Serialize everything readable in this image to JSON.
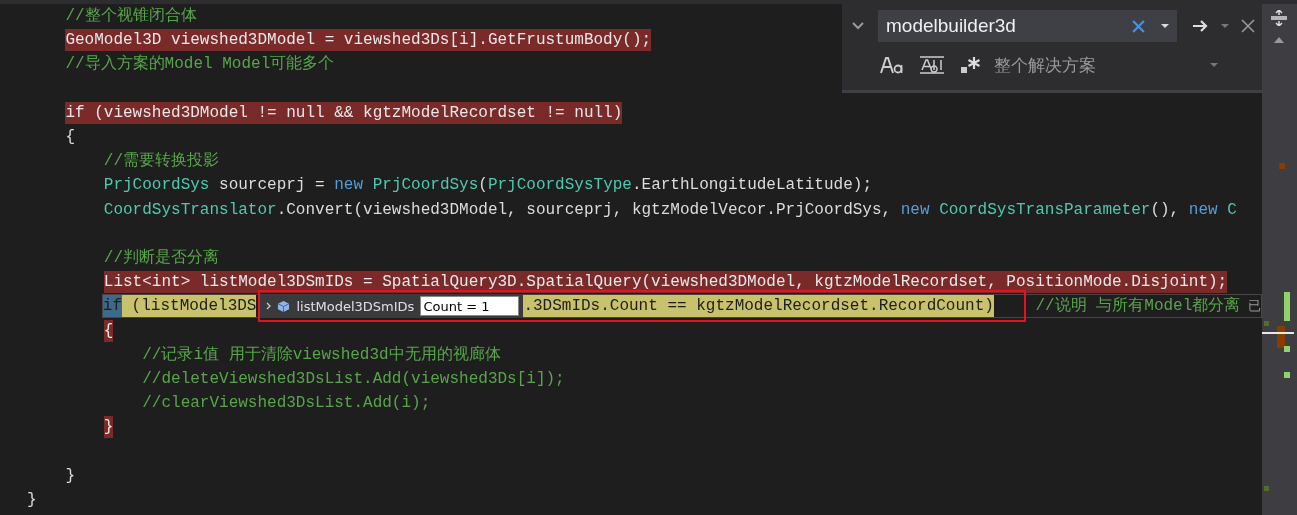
{
  "editor": {
    "blocks": [
      {
        "lines": [
          {
            "breakpoint": false,
            "current": false,
            "segments": [
              {
                "kind": "comment",
                "text": "    //整个视锥闭合体"
              }
            ]
          },
          {
            "breakpoint": true,
            "current": false,
            "segments": [
              {
                "kind": "plain",
                "text": "    GeoModel3D viewshed3DModel = viewshed3Ds[i].GetFrustumBody();"
              }
            ]
          },
          {
            "breakpoint": false,
            "current": false,
            "segments": [
              {
                "kind": "comment",
                "text": "    //导入方案的Model Model可能多个"
              }
            ]
          }
        ]
      },
      {
        "lines": [
          {
            "breakpoint": true,
            "current": false,
            "segments": [
              {
                "kind": "plain",
                "text": "    if (viewshed3DModel != null && kgtzModelRecordset != null)"
              }
            ]
          },
          {
            "breakpoint": false,
            "current": false,
            "segments": [
              {
                "kind": "plain",
                "text": "    {"
              }
            ]
          },
          {
            "breakpoint": false,
            "current": false,
            "segments": [
              {
                "kind": "comment",
                "text": "        //需要转换投影"
              }
            ]
          },
          {
            "breakpoint": false,
            "current": false,
            "segments": [
              {
                "kind": "type",
                "text": "        PrjCoordSys"
              },
              {
                "kind": "plain",
                "text": " sourceprj = "
              },
              {
                "kind": "keyword",
                "text": "new"
              },
              {
                "kind": "type",
                "text": " PrjCoordSys"
              },
              {
                "kind": "plain",
                "text": "("
              },
              {
                "kind": "type",
                "text": "PrjCoordSysType"
              },
              {
                "kind": "plain",
                "text": ".EarthLongitudeLatitude);"
              }
            ]
          },
          {
            "breakpoint": false,
            "current": false,
            "segments": [
              {
                "kind": "type",
                "text": "        CoordSysTranslator"
              },
              {
                "kind": "plain",
                "text": ".Convert(viewshed3DModel, sourceprj, kgtzModelVecor.PrjCoordSys, "
              },
              {
                "kind": "keyword",
                "text": "new"
              },
              {
                "kind": "type",
                "text": " CoordSysTransParameter"
              },
              {
                "kind": "plain",
                "text": "(), "
              },
              {
                "kind": "keyword",
                "text": "new"
              },
              {
                "kind": "type",
                "text": " C"
              }
            ]
          }
        ]
      },
      {
        "lines": [
          {
            "breakpoint": false,
            "current": false,
            "segments": [
              {
                "kind": "comment",
                "text": "        //判断是否分离"
              }
            ]
          },
          {
            "breakpoint": true,
            "current": false,
            "segments": [
              {
                "kind": "plain",
                "text": "        List<int> listModel3DSmIDs = SpatialQuery3D.SpatialQuery(viewshed3DModel, kgtzModelRecordset, PositionMode.Disjoint);"
              }
            ]
          },
          {
            "breakpoint": false,
            "current": true,
            "segments": [
              {
                "kind": "current-keyword",
                "text": "        if"
              },
              {
                "kind": "plain",
                "text": " (listModel3DS"
              },
              {
                "kind": "callout",
                "segments": [
                  {
                    "kind": "datatip",
                    "name": "listModel3DSmIDs",
                    "value": "Count = 1"
                  },
                  {
                    "kind": "plain",
                    "text": ".3DSmIDs.Count == kgtzModelRecordset.RecordCount)"
                  }
                ]
              },
              {
                "kind": "comment",
                "text": " //说明 与所有Model都分离"
              },
              {
                "kind": "hint",
                "text": "已"
              }
            ]
          },
          {
            "breakpoint": true,
            "current": false,
            "segments": [
              {
                "kind": "plain",
                "text": "        {"
              }
            ]
          },
          {
            "breakpoint": false,
            "current": false,
            "segments": [
              {
                "kind": "comment",
                "text": "            //记录i值 用于清除viewshed3d中无用的视廊体"
              }
            ]
          },
          {
            "breakpoint": false,
            "current": false,
            "segments": [
              {
                "kind": "comment",
                "text": "            //deleteViewshed3DsList.Add(viewshed3Ds[i]);"
              }
            ]
          },
          {
            "breakpoint": false,
            "current": false,
            "segments": [
              {
                "kind": "comment",
                "text": "            //clearViewshed3DsList.Add(i);"
              }
            ]
          },
          {
            "breakpoint": true,
            "current": false,
            "segments": [
              {
                "kind": "plain",
                "text": "        }"
              }
            ]
          }
        ]
      },
      {
        "lines": [
          {
            "breakpoint": false,
            "current": false,
            "segments": [
              {
                "kind": "plain",
                "text": "    }"
              }
            ]
          },
          {
            "breakpoint": false,
            "current": false,
            "segments": [
              {
                "kind": "plain",
                "text": "}"
              }
            ]
          }
        ]
      }
    ]
  },
  "find": {
    "query": "modelbuilder3d",
    "scope": "整个解决方案"
  }
}
